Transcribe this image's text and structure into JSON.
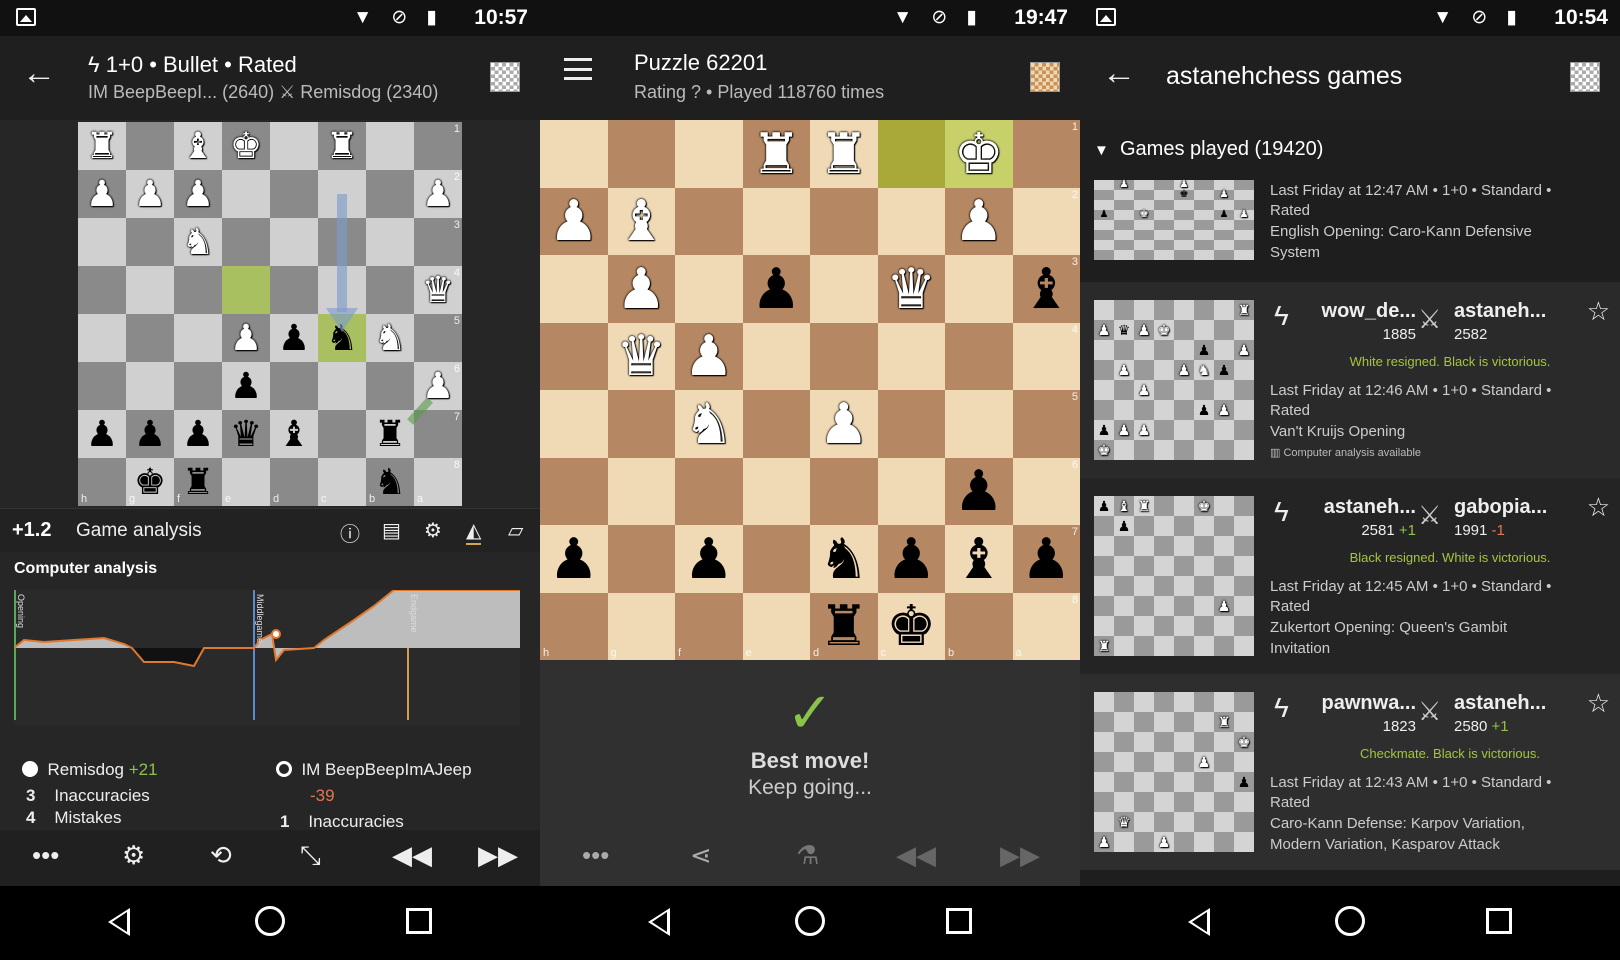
{
  "colors": {
    "accent": "#8bc34a",
    "negative": "#e07850",
    "board_gray_light": "#d0d0d0",
    "board_gray_dark": "#8a8a8a",
    "board_brown_light": "#f0d9b5",
    "board_brown_dark": "#b58863"
  },
  "screen1": {
    "status": {
      "time": "10:57"
    },
    "appbar": {
      "title": "1+0 • Bullet • Rated",
      "subtitle": "IM BeepBeepI... (2640) ⚔ Remisdog (2340)"
    },
    "board": {
      "ranks": [
        "1",
        "2",
        "3",
        "4",
        "5",
        "6",
        "7",
        "8"
      ],
      "files": [
        "h",
        "g",
        "f",
        "e",
        "d",
        "c",
        "b",
        "a"
      ],
      "pieces": [
        [
          "♜",
          "",
          "♝",
          "♚",
          "",
          "♜",
          "",
          ""
        ],
        [
          "♟",
          "♟",
          "♟",
          "",
          "",
          "",
          "",
          "♟"
        ],
        [
          "",
          "",
          "♞",
          "",
          "",
          "",
          "",
          ""
        ],
        [
          "",
          "",
          "",
          "",
          "",
          "",
          "",
          "♛"
        ],
        [
          "",
          "",
          "",
          "♟",
          "♟",
          "♞",
          "♞",
          ""
        ],
        [
          "",
          "",
          "",
          "♟",
          "",
          "",
          "",
          "♟"
        ],
        [
          "♟",
          "♟",
          "♟",
          "♛",
          "♝",
          "",
          "♜",
          ""
        ],
        [
          "",
          "♚",
          "♜",
          "",
          "",
          "",
          "♞",
          ""
        ]
      ],
      "owners": [
        [
          "w",
          "",
          "w",
          "w",
          "",
          "w",
          "",
          ""
        ],
        [
          "w",
          "w",
          "w",
          "",
          "",
          "",
          "",
          "w"
        ],
        [
          "",
          "",
          "w",
          "",
          "",
          "",
          "",
          ""
        ],
        [
          "",
          "",
          "",
          "",
          "",
          "",
          "",
          "w"
        ],
        [
          "",
          "",
          "",
          "w",
          "b",
          "b",
          "w",
          ""
        ],
        [
          "",
          "",
          "",
          "b",
          "",
          "",
          "",
          "w"
        ],
        [
          "b",
          "b",
          "b",
          "b",
          "b",
          "",
          "b",
          ""
        ],
        [
          "",
          "b",
          "b",
          "",
          "",
          "",
          "b",
          ""
        ]
      ]
    },
    "toolbar": {
      "eval": "+1.2",
      "label": "Game analysis"
    },
    "analysis": {
      "title": "Computer analysis",
      "phases": [
        "Opening",
        "Middlegame",
        "Endgame"
      ],
      "white": {
        "name": "Remisdog",
        "diff": "+21",
        "inaccuracies_count": "3",
        "inaccuracies_label": "Inaccuracies",
        "mistakes_count": "4",
        "mistakes_label": "Mistakes"
      },
      "black": {
        "name": "IM BeepBeepImAJeep",
        "diff": "-39",
        "inaccuracies_count": "1",
        "inaccuracies_label": "Inaccuracies"
      }
    },
    "icons": [
      "info-icon",
      "list-icon",
      "gears-icon",
      "chart-icon",
      "book-icon",
      "more-icon",
      "settings-icon",
      "flip-icon",
      "compress-icon",
      "backward-icon",
      "forward-icon"
    ]
  },
  "screen2": {
    "status": {
      "time": "19:47"
    },
    "appbar": {
      "title": "Puzzle 62201",
      "subtitle": "Rating ? • Played 118760 times"
    },
    "board": {
      "ranks": [
        "1",
        "2",
        "3",
        "4",
        "5",
        "6",
        "7",
        "8"
      ],
      "files": [
        "h",
        "g",
        "f",
        "e",
        "d",
        "c",
        "b",
        "a"
      ],
      "pieces": [
        [
          "",
          "",
          "",
          "♜",
          "♜",
          "",
          "♚",
          ""
        ],
        [
          "♟",
          "♝",
          "",
          "",
          "",
          "",
          "♟",
          ""
        ],
        [
          "",
          "♟",
          "",
          "♟",
          "",
          "♛",
          "",
          "♝"
        ],
        [
          "",
          "♛",
          "♟",
          "",
          "",
          "",
          "",
          ""
        ],
        [
          "",
          "",
          "♞",
          "",
          "♟",
          "",
          "",
          ""
        ],
        [
          "",
          "",
          "",
          "",
          "",
          "",
          "♟",
          ""
        ],
        [
          "♟",
          "",
          "♟",
          "",
          "♞",
          "♟",
          "♝",
          "♟"
        ],
        [
          "",
          "",
          "",
          "",
          "♜",
          "♚",
          "",
          ""
        ]
      ],
      "owners": [
        [
          "",
          "",
          "",
          "w",
          "w",
          "",
          "w",
          ""
        ],
        [
          "w",
          "w",
          "",
          "",
          "",
          "",
          "w",
          ""
        ],
        [
          "",
          "w",
          "",
          "b",
          "",
          "w",
          "",
          "b"
        ],
        [
          "",
          "w",
          "w",
          "",
          "",
          "",
          "",
          ""
        ],
        [
          "",
          "",
          "w",
          "",
          "w",
          "",
          "",
          ""
        ],
        [
          "",
          "",
          "",
          "",
          "",
          "",
          "b",
          ""
        ],
        [
          "b",
          "",
          "b",
          "",
          "b",
          "b",
          "b",
          "b"
        ],
        [
          "",
          "",
          "",
          "",
          "b",
          "b",
          "",
          ""
        ]
      ]
    },
    "feedback": {
      "check": "✓",
      "title": "Best move!",
      "subtitle": "Keep going..."
    }
  },
  "screen3": {
    "status": {
      "time": "10:54"
    },
    "appbar": {
      "title": "astanehchess games"
    },
    "section": {
      "arrow": "▼",
      "label": "Games played (19420)"
    },
    "games": [
      {
        "line1": "Last Friday at 12:47 AM • 1+0 • Standard •",
        "line2": "Rated",
        "line3": "English Opening: Caro-Kann Defensive",
        "line4": "System",
        "player1": "",
        "rating1": "",
        "diff1": "",
        "player2": "",
        "rating2": "",
        "diff2": "",
        "result": "",
        "analysis": "",
        "mini": [
          "",
          "♟",
          "",
          "",
          "♟",
          "",
          "",
          "",
          "",
          "",
          "",
          "",
          "♚",
          "",
          "♟",
          "",
          "",
          "",
          "",
          "",
          "",
          "",
          "",
          "",
          "♟",
          "",
          "♚",
          "",
          "",
          "",
          "♟",
          "♟",
          "",
          "",
          "",
          "",
          "",
          "",
          "",
          "",
          "",
          "",
          "",
          "",
          "",
          "",
          "",
          "",
          "",
          "",
          "",
          "",
          "",
          "",
          "",
          "",
          "",
          "",
          "",
          "",
          "",
          "",
          "",
          ""
        ]
      },
      {
        "player1": "wow_de...",
        "rating1": "1885",
        "diff1": "",
        "player2": "astaneh...",
        "rating2": "2582",
        "diff2": "",
        "result": "White resigned. Black is victorious.",
        "line1": "Last Friday at 12:46 AM • 1+0 • Standard •",
        "line2": "Rated",
        "line3": "Van't Kruijs Opening",
        "line4": "",
        "analysis": "Computer analysis available",
        "mini": [
          "",
          "",
          "",
          "",
          "",
          "",
          "",
          "♜",
          "♟",
          "♛",
          "♟",
          "♚",
          "",
          "",
          "",
          "",
          "",
          "",
          "",
          "",
          "",
          "♟",
          "",
          "♟",
          "",
          "♟",
          "",
          "",
          "♟",
          "♞",
          "♟",
          "",
          "",
          "",
          "♟",
          "",
          "",
          "",
          "",
          "",
          "",
          "",
          "",
          "",
          "",
          "♟",
          "♟",
          "",
          "♟",
          "♟",
          "♟",
          "",
          "",
          "",
          "",
          "",
          "♚",
          "",
          "",
          "",
          "",
          "",
          "",
          ""
        ]
      },
      {
        "player1": "astaneh...",
        "rating1": "2581",
        "diff1": "+1",
        "player2": "gabopia...",
        "rating2": "1991",
        "diff2": "-1",
        "result": "Black resigned. White is victorious.",
        "line1": "Last Friday at 12:45 AM • 1+0 • Standard •",
        "line2": "Rated",
        "line3": "Zukertort Opening: Queen's Gambit",
        "line4": "Invitation",
        "analysis": "",
        "mini": [
          "♟",
          "♝",
          "♜",
          "",
          "",
          "♚",
          "",
          "",
          "",
          "♟",
          "",
          "",
          "",
          "",
          "",
          "",
          "",
          "",
          "",
          "",
          "",
          "",
          "",
          "",
          "",
          "",
          "",
          "",
          "",
          "",
          "",
          "",
          "",
          "",
          "",
          "",
          "",
          "",
          "",
          "",
          "",
          "",
          "",
          "",
          "",
          "",
          "♟",
          "",
          "",
          "",
          "",
          "",
          "",
          "",
          "",
          "",
          "♜",
          "",
          "",
          "",
          ""
        ]
      },
      {
        "player1": "pawnwa...",
        "rating1": "1823",
        "diff1": "",
        "player2": "astaneh...",
        "rating2": "2580",
        "diff2": "+1",
        "result": "Checkmate. Black is victorious.",
        "line1": "Last Friday at 12:43 AM • 1+0 • Standard •",
        "line2": "Rated",
        "line3": "Caro-Kann Defense: Karpov Variation,",
        "line4": "Modern Variation, Kasparov Attack",
        "analysis": "",
        "mini": [
          "",
          "",
          "",
          "",
          "",
          "",
          "",
          "",
          "",
          "",
          "",
          "",
          "",
          "",
          "♜",
          "",
          "",
          "",
          "",
          "",
          "",
          "",
          "",
          "♚",
          "",
          "",
          "",
          "",
          "",
          "♟",
          "",
          "",
          "",
          "",
          "",
          "",
          "",
          "",
          "",
          "♟",
          "",
          "",
          "",
          "",
          "",
          "",
          "",
          "",
          "",
          "♛",
          "",
          "",
          "",
          "",
          "",
          "",
          "♟",
          "",
          "",
          "♟",
          "",
          "",
          "",
          "",
          ""
        ]
      }
    ]
  }
}
